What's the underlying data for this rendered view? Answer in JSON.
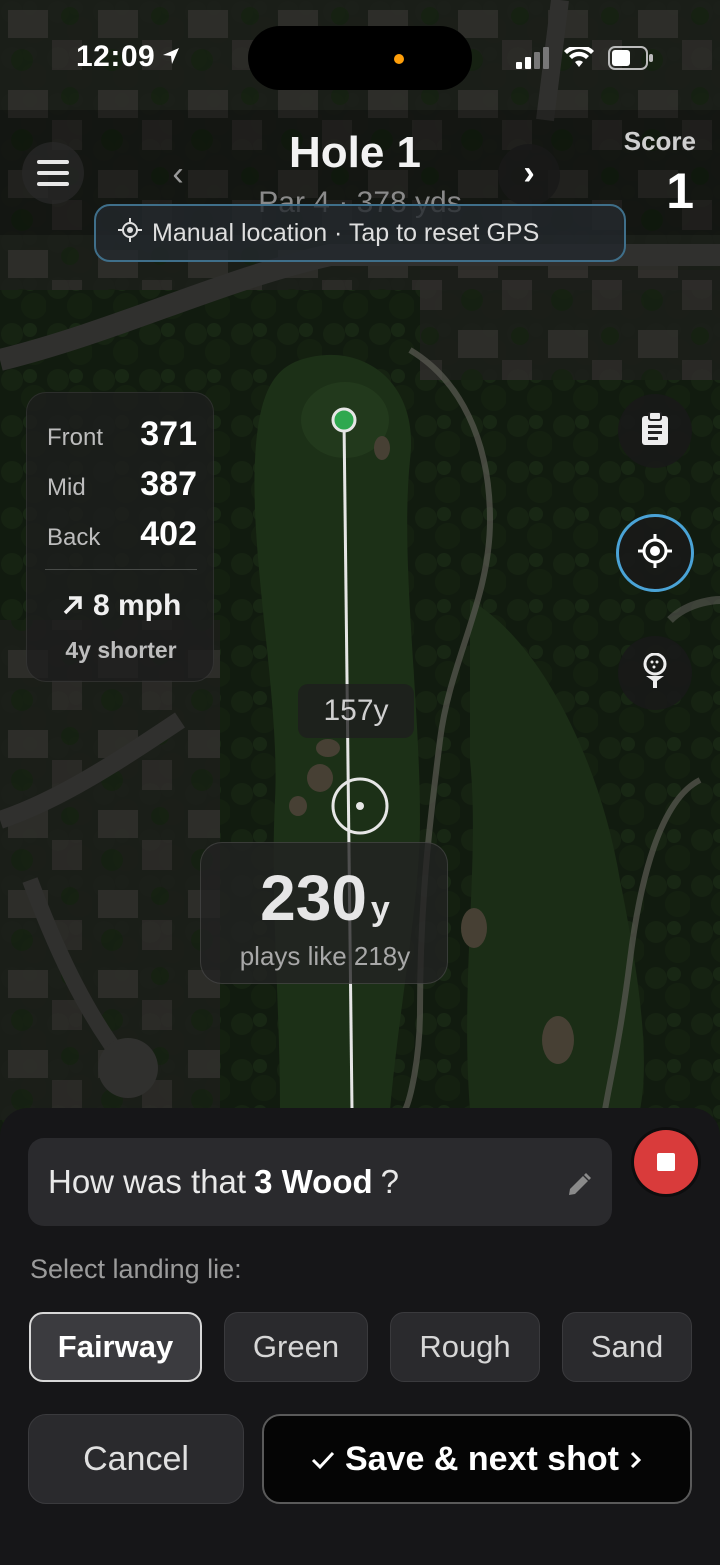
{
  "status_bar": {
    "time": "12:09",
    "location_icon": "location-arrow-icon",
    "signal_icon": "cellular-signal-icon",
    "wifi_icon": "wifi-icon",
    "battery_icon": "battery-icon"
  },
  "header": {
    "menu_icon": "hamburger-menu-icon",
    "hole_title": "Hole 1",
    "hole_subtitle": "Par 4  ·  378 yds",
    "prev_icon": "chevron-left-icon",
    "next_icon": "chevron-right-icon",
    "score_label": "Score",
    "score_value": "1",
    "gps_pill": "Manual location  ·  Tap to reset GPS",
    "gps_icon": "crosshair-icon"
  },
  "distances": {
    "front_label": "Front",
    "front_value": "371",
    "mid_label": "Mid",
    "mid_value": "387",
    "back_label": "Back",
    "back_value": "402",
    "wind": "8 mph",
    "wind_icon": "arrow-up-right-icon",
    "wind_effect": "4y shorter"
  },
  "side_buttons": [
    {
      "icon": "clipboard-icon",
      "active": false
    },
    {
      "icon": "gps-target-icon",
      "active": true
    },
    {
      "icon": "golf-tee-icon",
      "active": false
    }
  ],
  "map": {
    "segment_distance": "157y",
    "target_distance": "230",
    "target_unit": "y",
    "plays_like": "plays like 218y"
  },
  "sheet": {
    "question_prefix": "How was that",
    "question_club": "3 Wood",
    "question_suffix": "?",
    "edit_icon": "pencil-icon",
    "stop_icon": "stop-icon",
    "lie_label": "Select landing lie:",
    "lies": [
      {
        "label": "Fairway",
        "selected": true
      },
      {
        "label": "Green",
        "selected": false
      },
      {
        "label": "Rough",
        "selected": false
      },
      {
        "label": "Sand",
        "selected": false
      }
    ],
    "cancel_label": "Cancel",
    "save_label": "Save & next shot",
    "save_check_icon": "checkmark-icon",
    "save_chevron_icon": "chevron-right-icon"
  },
  "colors": {
    "stop_red": "#d93b3b",
    "gps_blue": "#4aa3d6",
    "pin_green": "#2fa84f",
    "status_orange": "#ff9f0a"
  }
}
